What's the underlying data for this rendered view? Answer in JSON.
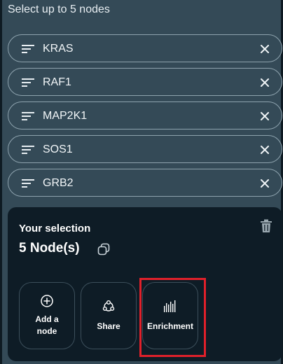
{
  "header": {
    "title": "Select up to 5 nodes"
  },
  "nodes": [
    {
      "label": "KRAS"
    },
    {
      "label": "RAF1"
    },
    {
      "label": "MAP2K1"
    },
    {
      "label": "SOS1"
    },
    {
      "label": "GRB2"
    }
  ],
  "selection": {
    "title": "Your selection",
    "count_text": "5 Node(s)"
  },
  "actions": [
    {
      "label": "Add a node",
      "icon": "plus-circle-icon"
    },
    {
      "label": "Share",
      "icon": "share-icon"
    },
    {
      "label": "Enrichment",
      "icon": "enrichment-icon"
    }
  ],
  "colors": {
    "panel_bg": "#344a57",
    "card_bg": "#0e1c26",
    "highlight": "#e0202a",
    "pill_border": "#8ea3ae"
  }
}
